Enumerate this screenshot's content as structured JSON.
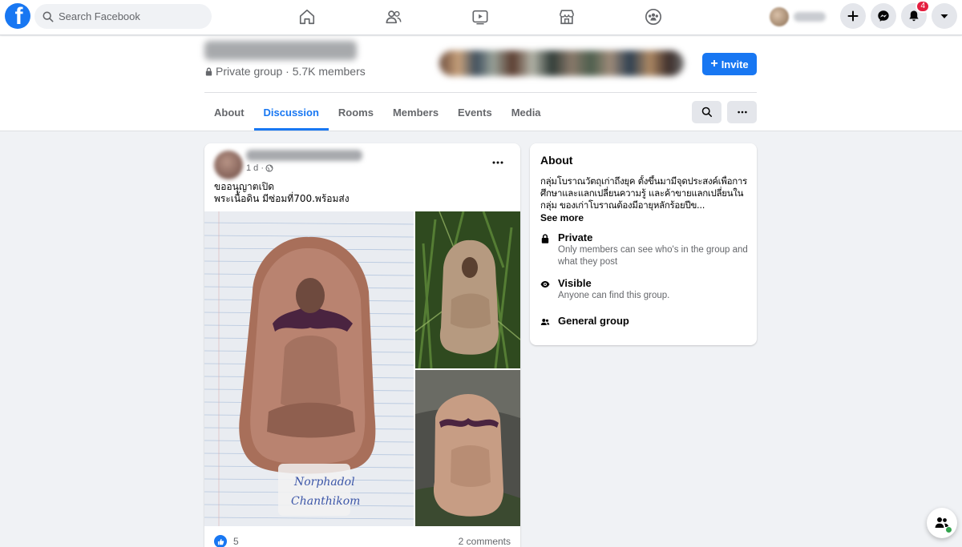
{
  "topbar": {
    "logo_letter": "f",
    "search_placeholder": "Search Facebook",
    "nav_icons": [
      "home-icon",
      "friends-icon",
      "watch-icon",
      "marketplace-icon",
      "groups-icon"
    ],
    "notifications_count": "4",
    "actions": [
      "create-icon",
      "messenger-icon",
      "bell-icon",
      "caret-down-icon"
    ]
  },
  "group": {
    "meta": "Private group · 5.7K members",
    "invite_label": "Invite",
    "tabs": [
      "About",
      "Discussion",
      "Rooms",
      "Members",
      "Events",
      "Media"
    ],
    "active_tab": "Discussion"
  },
  "post": {
    "time": "1 d ·",
    "line1": "ขออนุญาตเปิด",
    "line2": "พระเนื้อดิน มีซ่อมที่700.พร้อมส่ง",
    "photo_caption_line1": "Norphadol",
    "photo_caption_line2": "Chanthikom",
    "likes": "5",
    "comments": "2 comments"
  },
  "about": {
    "heading": "About",
    "description": "กลุ่มโบราณวัตถุเก่าถึงยุค ตั้งขึ้นมามีจุดประสงค์เพื่อการศึกษาและแลกเปลี่ยนความรู้ และค้าขายแลกเปลี่ยนในกลุ่ม ของเก่าโบราณต้องมีอายุหลักร้อยปีข...",
    "see_more": "See more",
    "private_title": "Private",
    "private_desc": "Only members can see who's in the group and what they post",
    "visible_title": "Visible",
    "visible_desc": "Anyone can find this group.",
    "general_title": "General group"
  },
  "colors": {
    "brand": "#1877f2",
    "background": "#f0f2f5",
    "badge": "#e41e3f"
  }
}
